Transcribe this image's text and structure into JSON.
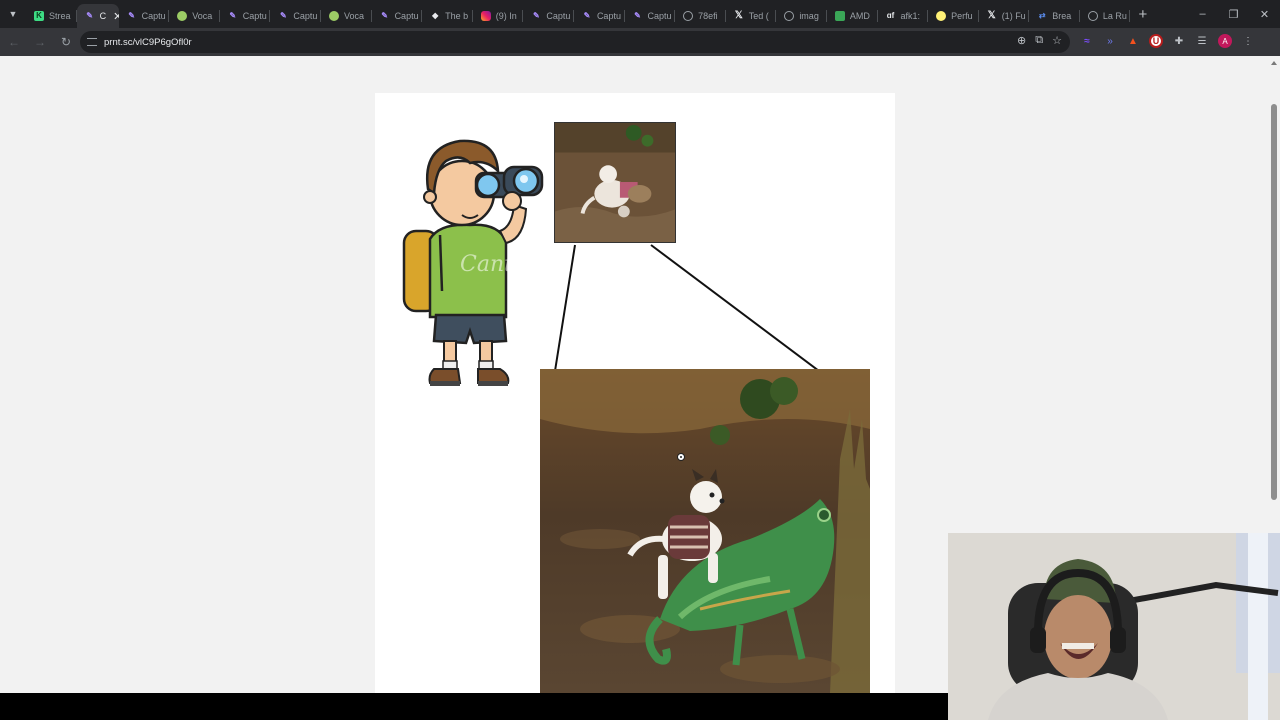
{
  "tabs": [
    {
      "label": "Strea",
      "icon": "green-k-icon"
    },
    {
      "label": "C",
      "icon": "pen-icon",
      "active": true
    },
    {
      "label": "Captu",
      "icon": "pen-icon"
    },
    {
      "label": "Voca",
      "icon": "vocab-icon"
    },
    {
      "label": "Captu",
      "icon": "pen-icon"
    },
    {
      "label": "Captu",
      "icon": "pen-icon"
    },
    {
      "label": "Voca",
      "icon": "vocab-icon"
    },
    {
      "label": "Captu",
      "icon": "pen-icon"
    },
    {
      "label": "The b",
      "icon": "diamond-icon"
    },
    {
      "label": "(9) In",
      "icon": "instagram-icon"
    },
    {
      "label": "Captu",
      "icon": "pen-icon"
    },
    {
      "label": "Captu",
      "icon": "pen-icon"
    },
    {
      "label": "Captu",
      "icon": "pen-icon"
    },
    {
      "label": "78efi",
      "icon": "globe-icon"
    },
    {
      "label": "Ted (",
      "icon": "x-icon"
    },
    {
      "label": "imag",
      "icon": "globe-icon"
    },
    {
      "label": "AMD",
      "icon": "amd-icon"
    },
    {
      "label": "afk1:",
      "icon": "afk-icon"
    },
    {
      "label": "Perfu",
      "icon": "perfume-icon"
    },
    {
      "label": "(1) Fu",
      "icon": "x-icon"
    },
    {
      "label": "Brea",
      "icon": "break-icon"
    },
    {
      "label": "La Ru",
      "icon": "globe-icon"
    }
  ],
  "toolbar": {
    "url": "prnt.sc/vlC9P6gOfl0r"
  },
  "extensions": {
    "avatar_letter": "A"
  },
  "page": {
    "watermark": "Cant"
  }
}
